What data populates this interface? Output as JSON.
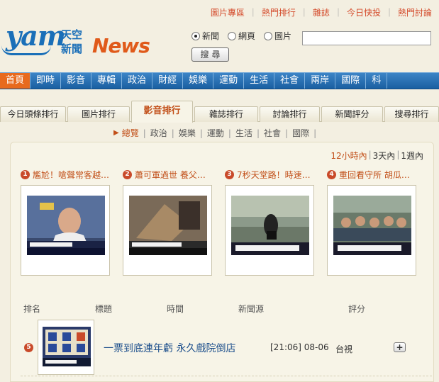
{
  "top_links": [
    "圖片專區",
    "熱門排行",
    "雜誌",
    "今日快投",
    "熱門討論"
  ],
  "logo": {
    "brand": "yam",
    "cn_line1": "天空",
    "cn_line2": "新聞",
    "news": "News"
  },
  "search": {
    "options": [
      {
        "label": "新聞",
        "selected": true
      },
      {
        "label": "網頁",
        "selected": false
      },
      {
        "label": "圖片",
        "selected": false
      }
    ],
    "value": "",
    "button": "搜尋"
  },
  "nav": [
    "首頁",
    "即時",
    "影音",
    "專輯",
    "政治",
    "財經",
    "娛樂",
    "運動",
    "生活",
    "社會",
    "兩岸",
    "國際",
    "科"
  ],
  "rank_tabs": [
    "今日頭條排行",
    "圖片排行",
    "影音排行",
    "雜誌排行",
    "討論排行",
    "新聞評分",
    "搜尋排行"
  ],
  "active_rank_tab": "影音排行",
  "subcategories": [
    "總覽",
    "政治",
    "娛樂",
    "運動",
    "生活",
    "社會",
    "國際"
  ],
  "time_ranges": [
    "12小時內",
    "3天內",
    "1週內"
  ],
  "top_videos": [
    {
      "rank": "1",
      "title": "尷尬！嗆聲常客越…"
    },
    {
      "rank": "2",
      "title": "蕭可軍過世 養父…"
    },
    {
      "rank": "3",
      "title": "7秒天堂路！時速…"
    },
    {
      "rank": "4",
      "title": "重回看守所 胡瓜…"
    }
  ],
  "table_headers": {
    "rank": "排名",
    "title": "標題",
    "time": "時間",
    "source": "新聞源",
    "score": "評分"
  },
  "rows": [
    {
      "rank": "5",
      "headline": "一票到底連年虧 永久戲院倒店",
      "time": "[21:06]",
      "date": "08-06",
      "source": "台視",
      "action": "+"
    }
  ],
  "colors": {
    "accent": "#c2501a",
    "nav_blue": "#1a5fa1",
    "nav_active": "#e86a1e",
    "bg": "#f3efe1"
  }
}
